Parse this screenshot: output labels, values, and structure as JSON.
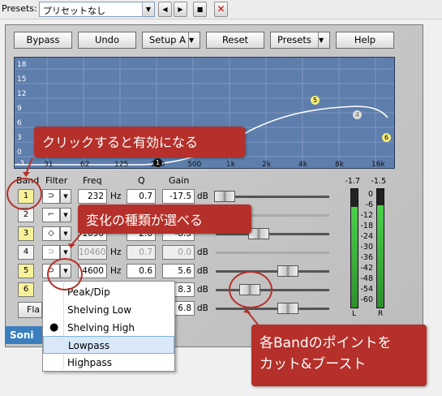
{
  "topbar": {
    "label": "Presets:",
    "preset_value": "プリセットなし"
  },
  "toolbar": {
    "bypass": "Bypass",
    "undo": "Undo",
    "setup": "Setup A",
    "reset": "Reset",
    "presets": "Presets",
    "help": "Help"
  },
  "graph": {
    "db_labels": [
      "18",
      "15",
      "12",
      "9",
      "6",
      "3",
      "0",
      "-3"
    ],
    "freq_labels": [
      "16",
      "31",
      "62",
      "125",
      "250",
      "500",
      "1k",
      "2k",
      "4k",
      "8k",
      "16k"
    ],
    "point_labels": [
      "1",
      "5",
      "4",
      "6"
    ]
  },
  "notes": {
    "click": "クリックすると有効になる",
    "filter": "変化の種類が選べる",
    "band_line1": "各Bandのポイントを",
    "band_line2": "カット&ブースト"
  },
  "columns": {
    "band": "Band",
    "filter": "Filter",
    "freq": "Freq",
    "q": "Q",
    "gain": "Gain"
  },
  "bands": [
    {
      "num": "1",
      "freq": "232",
      "q": "0.7",
      "gain": "-17.5",
      "active": true
    },
    {
      "num": "2",
      "freq": "",
      "q": "",
      "gain": "",
      "active": false
    },
    {
      "num": "3",
      "freq": "1096",
      "q": "2.0",
      "gain": "-8.3",
      "active": true
    },
    {
      "num": "4",
      "freq": "10460",
      "q": "0.7",
      "gain": "0.0",
      "active": false
    },
    {
      "num": "5",
      "freq": "4600",
      "q": "0.6",
      "gain": "5.6",
      "active": true
    },
    {
      "num": "6",
      "freq": "",
      "q": "",
      "gain": "8.3",
      "active": true
    }
  ],
  "units": {
    "hz": "Hz",
    "db": "dB"
  },
  "meter": {
    "left_peak": "-1.7",
    "right_peak": "-1.5",
    "scale": [
      "0",
      "-6",
      "-12",
      "-18",
      "-24",
      "-30",
      "-36",
      "-42",
      "-48",
      "-54",
      "-60"
    ],
    "left_label": "L",
    "right_label": "R"
  },
  "filter_menu": {
    "items": [
      "Peak/Dip",
      "Shelving Low",
      "Shelving High",
      "Lowpass",
      "Highpass"
    ],
    "checked": "Shelving High",
    "highlighted": "Lowpass"
  },
  "bottom": {
    "flat_partial": "Fla",
    "brand_partial": "Soni",
    "gain_partial_last": "6.8"
  }
}
